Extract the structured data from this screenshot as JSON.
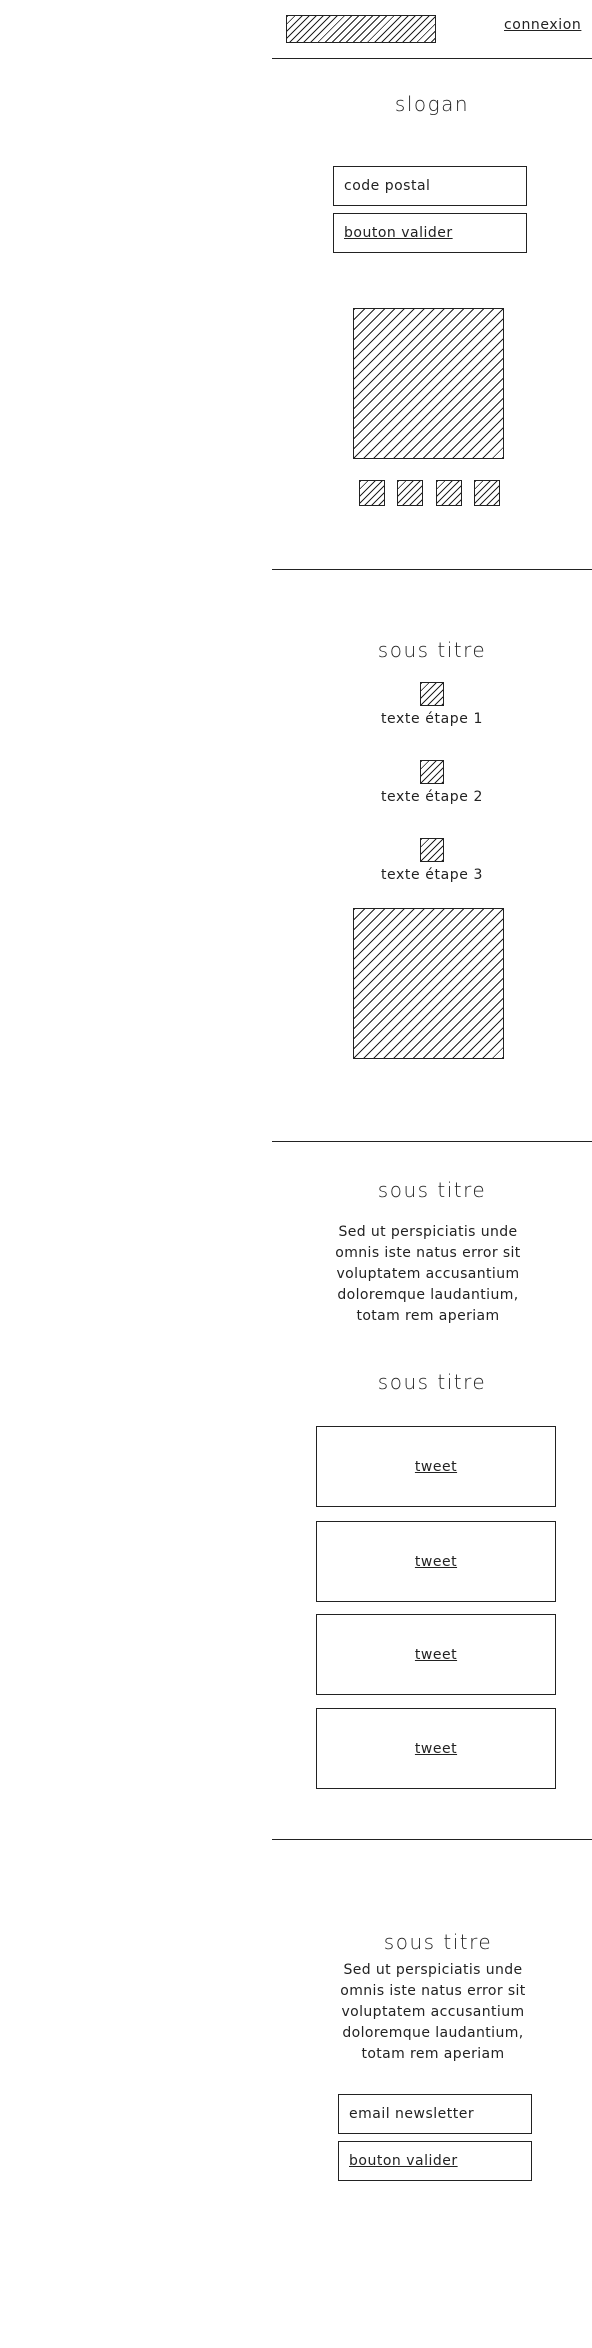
{
  "header": {
    "logo_icon": "logo-placeholder",
    "login_link": "connexion"
  },
  "hero": {
    "slogan": "slogan",
    "postal_code_placeholder": "code postal",
    "submit_label": "bouton valider",
    "main_image_icon": "image-placeholder",
    "thumbnails": [
      "image-placeholder",
      "image-placeholder",
      "image-placeholder",
      "image-placeholder"
    ]
  },
  "steps_section": {
    "title": "sous titre",
    "steps": [
      {
        "icon": "image-placeholder",
        "label": "texte étape 1"
      },
      {
        "icon": "image-placeholder",
        "label": "texte étape 2"
      },
      {
        "icon": "image-placeholder",
        "label": "texte étape 3"
      }
    ],
    "image_icon": "image-placeholder"
  },
  "about_section": {
    "title": "sous titre",
    "text_lines": [
      "Sed ut perspiciatis unde",
      "omnis iste natus error sit",
      "voluptatem accusantium",
      "doloremque laudantium,",
      "totam rem aperiam"
    ]
  },
  "tweets_section": {
    "title": "sous titre",
    "tweets": [
      "tweet",
      "tweet",
      "tweet",
      "tweet"
    ]
  },
  "newsletter_section": {
    "title": "sous titre",
    "text_lines": [
      "Sed ut perspiciatis unde",
      "omnis iste natus error sit",
      "voluptatem accusantium",
      "doloremque laudantium,",
      "totam rem aperiam"
    ],
    "email_placeholder": "email newsletter",
    "submit_label": "bouton valider"
  }
}
